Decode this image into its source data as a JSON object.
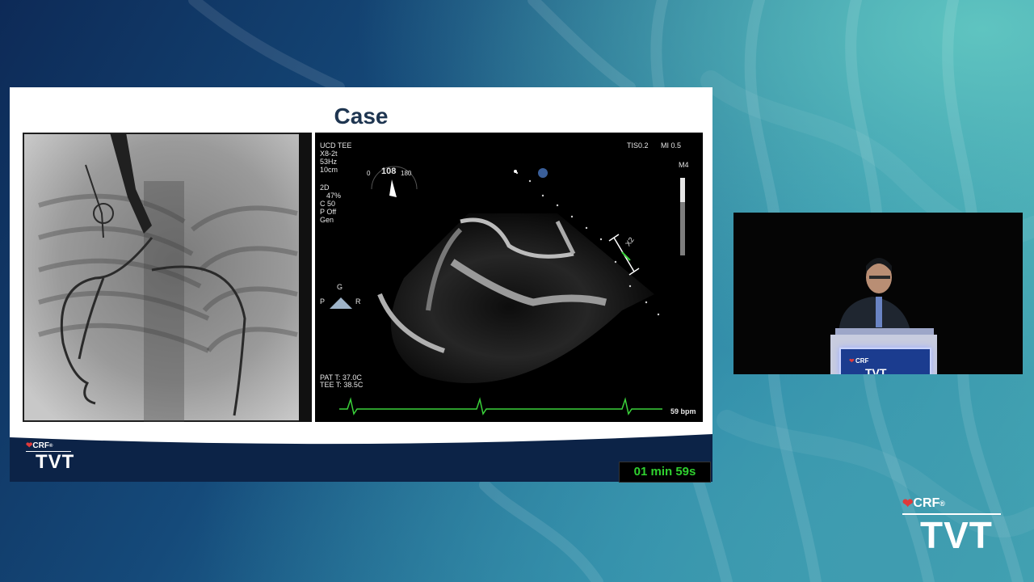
{
  "slide": {
    "title": "Case",
    "echo": {
      "header": [
        "UCD TEE",
        "X8-2t",
        "53Hz",
        "10cm"
      ],
      "mode": [
        "2D",
        "47%",
        "C 50",
        "P Off",
        "Gen"
      ],
      "tis": "TIS0.2",
      "mi": "MI 0.5",
      "probe": "M4",
      "angle_min": "0",
      "angle": "108",
      "angle_max": "180",
      "orient_top": "G",
      "orient_left": "P",
      "orient_right": "R",
      "pat_temp": "PAT T: 37.0C",
      "tee_temp": "TEE T: 38.5C",
      "heart_rate": "59 bpm",
      "caliper_label": "X2"
    },
    "logo": {
      "brand": "CRF",
      "reg": "®",
      "event": "TVT"
    }
  },
  "timer": "01 min 59s",
  "corner_logo": {
    "brand": "CRF",
    "reg": "®",
    "event": "TVT"
  },
  "video": {
    "podium_brand": "CRF",
    "podium_event": "TVT"
  },
  "colors": {
    "title": "#1e3550",
    "timer_text": "#2fd02f",
    "ecg": "#3ad13a",
    "heart": "#e03a3a"
  }
}
